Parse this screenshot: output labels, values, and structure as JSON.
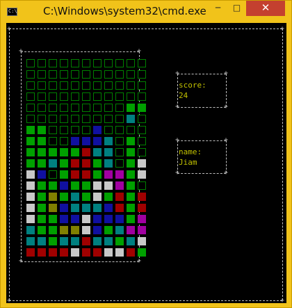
{
  "window": {
    "title": "C:\\Windows\\system32\\cmd.exe",
    "icon_text": "C:\\",
    "minimize": "─",
    "maximize": "□",
    "close": "✕"
  },
  "panels": {
    "score_label": "score:",
    "score_value": "24",
    "name_label": "name:",
    "name_value": "Jiam"
  },
  "colors": {
    "E": "empty",
    "G": "#00a000",
    "B": "#1010a0",
    "C": "#008080",
    "R": "#a00000",
    "Y": "#808000",
    "W": "#c8c8c8",
    "M": "#a000a0"
  },
  "board": [
    "EEEEEEEEEEE",
    "EEEEEEEEEEE",
    "EEEEEEEEEEE",
    "EEEEEEEEEEE",
    "EEEEEEEEEGG",
    "EEEEEEEEECE",
    "GGEEEEBEEEE",
    "GGEEBBBCEGE",
    "GGGGGRCCEGE",
    "GGCGRRGCEGW",
    "WBEGRRGMMGW",
    "WGGBGGWWMGE",
    "WGYGCGWGRGR",
    "WGYBCCCBRGR",
    "WGGBBWBBBGM",
    "CGGYYWBGCMM",
    "CCGCCRCCGCW",
    "RRRRWRRWWRG"
  ]
}
